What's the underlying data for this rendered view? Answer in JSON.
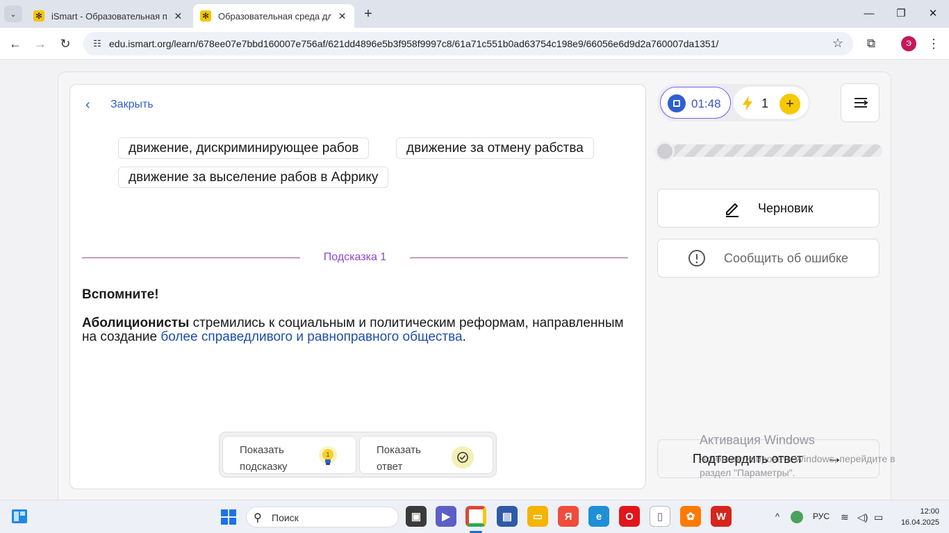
{
  "browser": {
    "tabs": [
      {
        "title": "iSmart - Образовательная пла",
        "favicon": "ismart-logo-icon",
        "active": false
      },
      {
        "title": "Образовательная среда для са",
        "favicon": "ismart-logo-icon",
        "active": true
      }
    ],
    "url": "edu.ismart.org/learn/678ee07e7bbd160007e756af/621dd4896e5b3f958f9997c8/61a71c551b0ad63754c198e9/66056e6d9d2a760007da1351/",
    "profile_initial": "Э"
  },
  "task": {
    "close_label": "Закрыть",
    "options": [
      "движение, дискриминирующее рабов",
      "движение за отмену рабства",
      "движение за выселение рабов в Африку"
    ]
  },
  "hint": {
    "title": "Подсказка  1",
    "heading": "Вспомните!",
    "text_bold": "Аболиционисты",
    "text_plain": " стремились к социальным и политическим реформам, направленным на создание ",
    "text_link": "более справедливого и равноправного общества",
    "text_end": "."
  },
  "actions": {
    "show_hint": "Показать подсказку",
    "hint_count": "1",
    "show_answer": "Показать ответ"
  },
  "panel": {
    "timer": "01:48",
    "energy": "1",
    "progress": 0.0,
    "draft_label": "Черновик",
    "report_label": "Сообщить об ошибке",
    "submit_label": "Подтвердить ответ"
  },
  "watermark": {
    "title": "Активация Windows",
    "subtitle": "Чтобы активировать Windows, перейдите в раздел \"Параметры\"."
  },
  "taskbar": {
    "search_placeholder": "Поиск",
    "lang": "РУС",
    "time": "12:00",
    "date": "16.04.2025"
  },
  "colors": {
    "accent_blue": "#2f5fd0",
    "hint_purple": "#8a46d8",
    "energy_yellow": "#f6c900"
  }
}
